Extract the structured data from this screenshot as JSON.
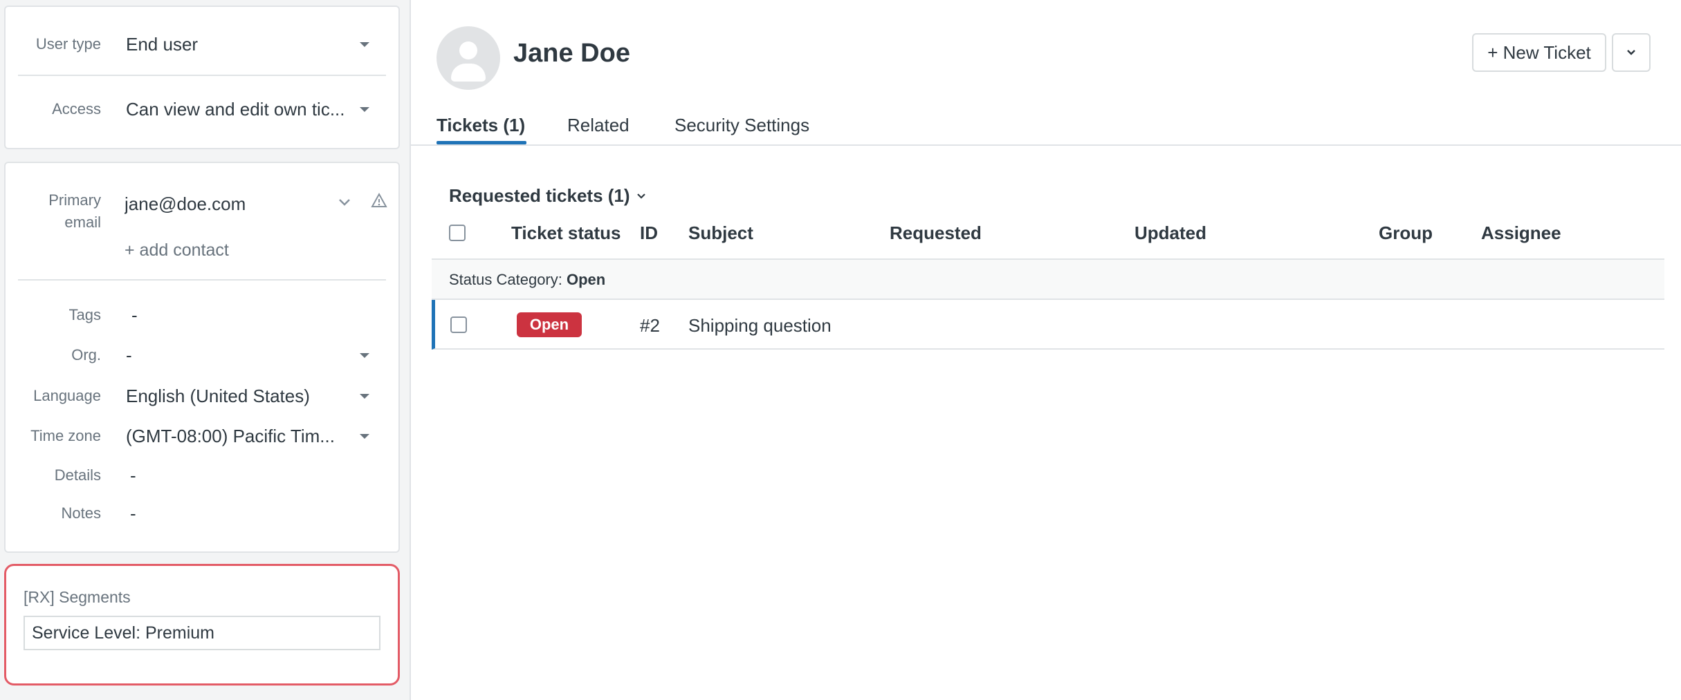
{
  "sidebar": {
    "user_type": {
      "label": "User type",
      "value": "End user"
    },
    "access": {
      "label": "Access",
      "value": "Can view and edit own tic..."
    },
    "primary_email": {
      "label_line1": "Primary",
      "label_line2": "email",
      "value": "jane@doe.com"
    },
    "add_contact": "+ add contact",
    "tags": {
      "label": "Tags",
      "value": "-"
    },
    "org": {
      "label": "Org.",
      "value": "-"
    },
    "language": {
      "label": "Language",
      "value": "English (United States)"
    },
    "time_zone": {
      "label": "Time zone",
      "value": "(GMT-08:00) Pacific Tim..."
    },
    "details": {
      "label": "Details",
      "value": "-"
    },
    "notes": {
      "label": "Notes",
      "value": "-"
    },
    "segments": {
      "label": "[RX] Segments",
      "value": "Service Level: Premium"
    }
  },
  "header": {
    "user_name": "Jane Doe",
    "new_ticket_label": "+ New Ticket"
  },
  "tabs": [
    {
      "label": "Tickets (1)",
      "active": true
    },
    {
      "label": "Related",
      "active": false
    },
    {
      "label": "Security Settings",
      "active": false
    }
  ],
  "tickets": {
    "section_title": "Requested tickets (1)",
    "columns": [
      "Ticket status",
      "ID",
      "Subject",
      "Requested",
      "Updated",
      "Group",
      "Assignee"
    ],
    "group_label_prefix": "Status Category:",
    "group_label_value": "Open",
    "rows": [
      {
        "status": "Open",
        "id": "#2",
        "subject": "Shipping question"
      }
    ]
  },
  "colors": {
    "accent": "#1f73b7",
    "open_badge": "#cc3340",
    "highlight_border": "#e35b66"
  }
}
